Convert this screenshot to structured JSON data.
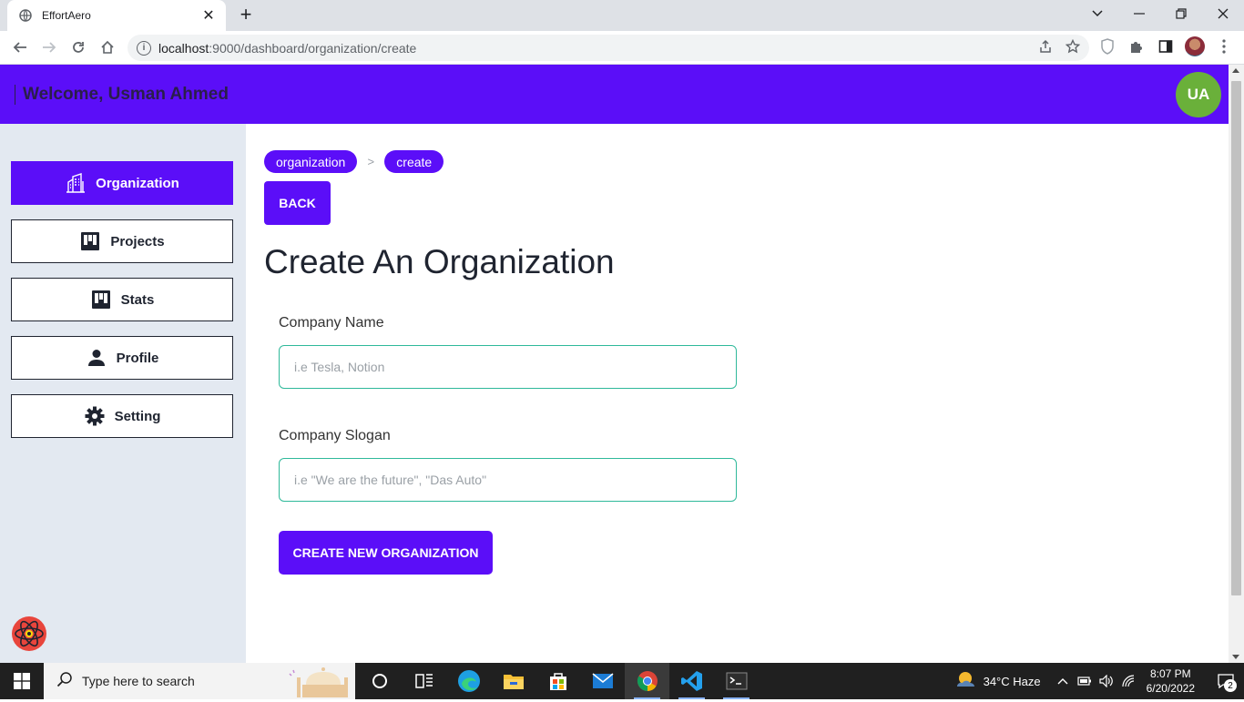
{
  "browser": {
    "tab_title": "EffortAero",
    "url_host": "localhost",
    "url_path": ":9000/dashboard/organization/create"
  },
  "header": {
    "welcome": "Welcome, Usman Ahmed",
    "avatar_initials": "UA"
  },
  "sidebar": {
    "items": [
      {
        "label": "Organization",
        "icon": "building-icon",
        "active": true
      },
      {
        "label": "Projects",
        "icon": "board-icon",
        "active": false
      },
      {
        "label": "Stats",
        "icon": "board-icon",
        "active": false
      },
      {
        "label": "Profile",
        "icon": "person-icon",
        "active": false
      },
      {
        "label": "Setting",
        "icon": "gear-icon",
        "active": false
      }
    ]
  },
  "main": {
    "breadcrumbs": [
      "organization",
      "create"
    ],
    "breadcrumb_separator": ">",
    "back_label": "BACK",
    "title": "Create An Organization",
    "company_name_label": "Company Name",
    "company_name_placeholder": "i.e Tesla, Notion",
    "company_slogan_label": "Company Slogan",
    "company_slogan_placeholder": "i.e \"We are the future\", \"Das Auto\"",
    "submit_label": "CREATE NEW ORGANIZATION"
  },
  "taskbar": {
    "search_placeholder": "Type here to search",
    "weather": "34°C  Haze",
    "time": "8:07 PM",
    "date": "6/20/2022",
    "notification_count": "2"
  },
  "colors": {
    "accent": "#5b0ef8",
    "avatar": "#6ab03a",
    "input_border": "#2fb99a",
    "sidebar_bg": "#e3e9f1"
  }
}
